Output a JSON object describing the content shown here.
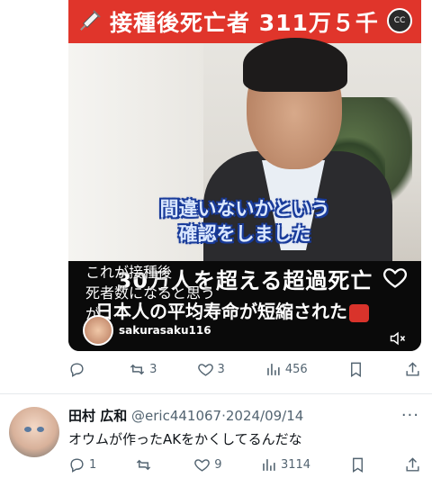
{
  "video": {
    "banner_text": "接種後死亡者 311万５千",
    "cc_label": "CC",
    "subtitle_line1": "間違いないかという",
    "subtitle_line2": "確認をしました",
    "caption_big": "30万人を超える超過死亡",
    "caption_big2": "日本人の平均寿命が短縮された",
    "overlay_caption_line1": "これが接種後",
    "overlay_caption_line2": "死者数になると思う",
    "overlay_caption_line3": "が",
    "handle": "sakurasaku116"
  },
  "post_actions": {
    "reply_count": "",
    "retweet_count": "3",
    "like_count": "3",
    "view_count": "456"
  },
  "reply_post": {
    "display_name": "田村 広和",
    "handle": "@eric441067",
    "date": "·2024/09/14",
    "more": "···",
    "text": "オウムが作ったAKをかくしてるんだな",
    "reply_count": "1",
    "retweet_count": "",
    "like_count": "9",
    "view_count": "3114"
  },
  "colors": {
    "banner_red": "#e0352b",
    "icon_gray": "#536471",
    "text_dark": "#0f1419"
  },
  "icons": [
    "syringe-icon",
    "cc-icon",
    "heart-icon",
    "mute-icon",
    "reply-icon",
    "retweet-icon",
    "like-icon",
    "views-icon",
    "bookmark-icon",
    "share-icon"
  ]
}
